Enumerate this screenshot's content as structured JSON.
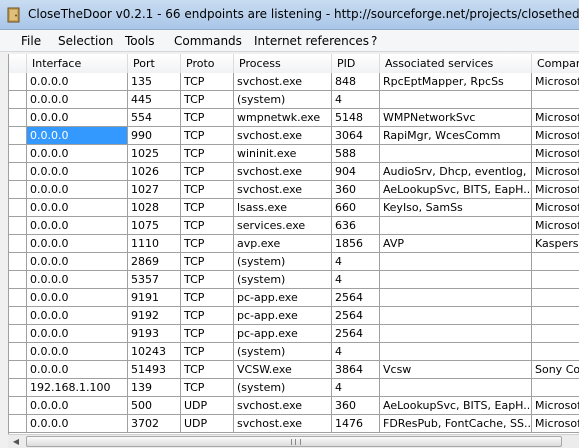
{
  "window": {
    "title": "CloseTheDoor v0.2.1 - 66 endpoints are listening - http://sourceforge.net/projects/closethedoor/"
  },
  "menu": [
    "File",
    "Selection",
    "Tools",
    "Commands",
    "Internet references",
    "?"
  ],
  "columns": [
    "Interface",
    "Port",
    "Proto",
    "Process",
    "PID",
    "Associated services",
    "Company"
  ],
  "rows": [
    [
      "0.0.0.0",
      "135",
      "TCP",
      "svchost.exe",
      "848",
      "RpcEptMapper, RpcSs",
      "Microsoft C"
    ],
    [
      "0.0.0.0",
      "445",
      "TCP",
      "(system)",
      "4",
      "",
      ""
    ],
    [
      "0.0.0.0",
      "554",
      "TCP",
      "wmpnetwk.exe",
      "5148",
      "WMPNetworkSvc",
      "Microsoft C"
    ],
    [
      "0.0.0.0",
      "990",
      "TCP",
      "svchost.exe",
      "3064",
      "RapiMgr, WcesComm",
      "Microsoft C"
    ],
    [
      "0.0.0.0",
      "1025",
      "TCP",
      "wininit.exe",
      "588",
      "",
      "Microsoft C"
    ],
    [
      "0.0.0.0",
      "1026",
      "TCP",
      "svchost.exe",
      "904",
      "AudioSrv, Dhcp, eventlog, ...",
      "Microsoft C"
    ],
    [
      "0.0.0.0",
      "1027",
      "TCP",
      "svchost.exe",
      "360",
      "AeLookupSvc, BITS, EapH...",
      "Microsoft C"
    ],
    [
      "0.0.0.0",
      "1028",
      "TCP",
      "lsass.exe",
      "660",
      "KeyIso, SamSs",
      "Microsoft C"
    ],
    [
      "0.0.0.0",
      "1075",
      "TCP",
      "services.exe",
      "636",
      "",
      "Microsoft C"
    ],
    [
      "0.0.0.0",
      "1110",
      "TCP",
      "avp.exe",
      "1856",
      "AVP",
      "Kaspersky"
    ],
    [
      "0.0.0.0",
      "2869",
      "TCP",
      "(system)",
      "4",
      "",
      ""
    ],
    [
      "0.0.0.0",
      "5357",
      "TCP",
      "(system)",
      "4",
      "",
      ""
    ],
    [
      "0.0.0.0",
      "9191",
      "TCP",
      "pc-app.exe",
      "2564",
      "",
      ""
    ],
    [
      "0.0.0.0",
      "9192",
      "TCP",
      "pc-app.exe",
      "2564",
      "",
      ""
    ],
    [
      "0.0.0.0",
      "9193",
      "TCP",
      "pc-app.exe",
      "2564",
      "",
      ""
    ],
    [
      "0.0.0.0",
      "10243",
      "TCP",
      "(system)",
      "4",
      "",
      ""
    ],
    [
      "0.0.0.0",
      "51493",
      "TCP",
      "VCSW.exe",
      "3864",
      "Vcsw",
      "Sony Corp"
    ],
    [
      "192.168.1.100",
      "139",
      "TCP",
      "(system)",
      "4",
      "",
      ""
    ],
    [
      "0.0.0.0",
      "500",
      "UDP",
      "svchost.exe",
      "360",
      "AeLookupSvc, BITS, EapH...",
      "Microsoft C"
    ],
    [
      "0.0.0.0",
      "3702",
      "UDP",
      "svchost.exe",
      "1476",
      "FDResPub, FontCache, SS...",
      "Microsoft C"
    ]
  ],
  "selected_row": 3,
  "colors": {
    "selection": "#3399ff",
    "titlebar": "#b9d1ee"
  }
}
